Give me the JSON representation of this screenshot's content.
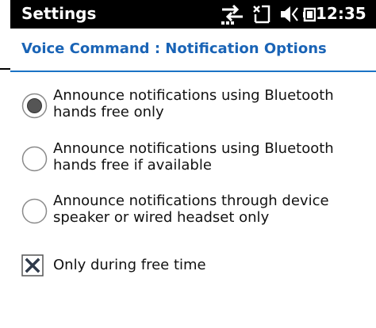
{
  "status": {
    "title": "Settings",
    "time": "12:35",
    "icons": [
      "network-sync-icon",
      "signal-icon",
      "volume-icon",
      "battery-icon"
    ]
  },
  "header": {
    "title": "Voice Command : Notification Options"
  },
  "options": [
    {
      "line1": "Announce notifications using Bluetooth",
      "line2": "hands free only",
      "selected": true
    },
    {
      "line1": "Announce notifications using Bluetooth",
      "line2": "hands free if available",
      "selected": false
    },
    {
      "line1": "Announce notifications through device",
      "line2": "speaker or wired headset only",
      "selected": false
    }
  ],
  "checkbox": {
    "label": "Only during free time",
    "checked": true
  },
  "colors": {
    "accent": "#1a64b6",
    "statusbar": "#000000"
  }
}
